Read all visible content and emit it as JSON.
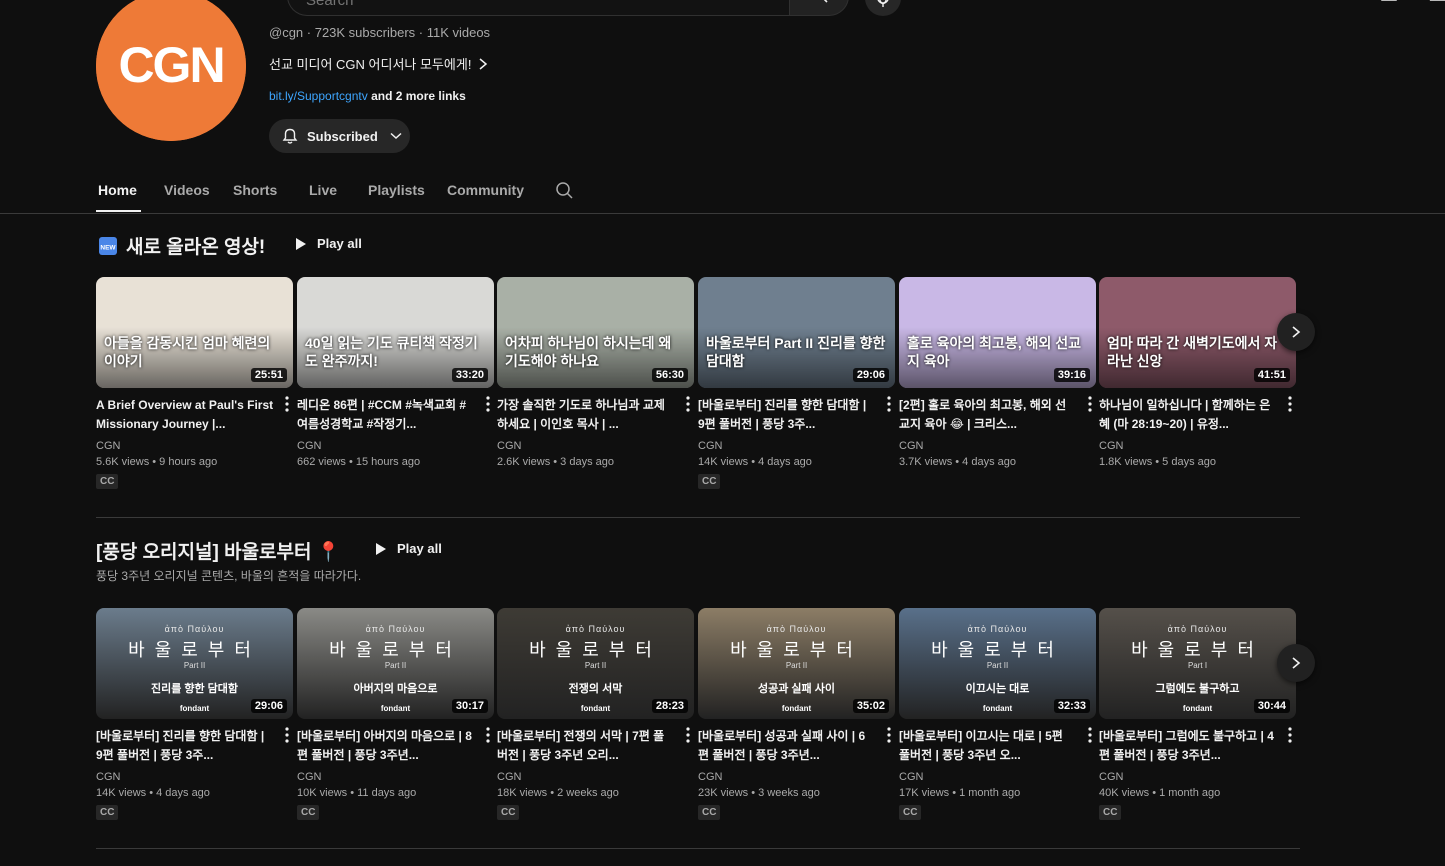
{
  "topbar": {
    "search_placeholder": "Search"
  },
  "channel": {
    "logo_text": "CGN",
    "handle_line": "@cgn · 723K subscribers · 11K videos",
    "tagline": "선교 미디어 CGN 어디서나 모두에게!",
    "link": "bit.ly/Supportcgntv",
    "more_links": "and 2 more links",
    "subscribe_label": "Subscribed",
    "brand_color": "#ee7a37"
  },
  "tabs": [
    "Home",
    "Videos",
    "Shorts",
    "Live",
    "Playlists",
    "Community"
  ],
  "sections": [
    {
      "badge": "NEW",
      "title": "새로 올라온 영상!",
      "play_all": "Play all",
      "videos": [
        {
          "thumb_text": "아들을 감동시킨 엄마 혜련의 이야기",
          "duration": "25:51",
          "title": "A Brief Overview at Paul's First Missionary Journey |...",
          "channel": "CGN",
          "meta": "5.6K views • 9 hours ago",
          "cc": "CC",
          "bg": "#e8e1d6"
        },
        {
          "thumb_text": "40일 읽는 기도 큐티책 작정기도 완주까지!",
          "duration": "33:20",
          "title": "레디온 86편 | #CCM #녹색교회 #여름성경학교 #작정기...",
          "channel": "CGN",
          "meta": "662 views • 15 hours ago",
          "cc": "",
          "bg": "#d9d9d6"
        },
        {
          "thumb_text": "어차피 하나님이 하시는데 왜 기도해야 하나요",
          "duration": "56:30",
          "title": "가장 솔직한 기도로 하나님과 교제하세요 | 이인호 목사 | ...",
          "channel": "CGN",
          "meta": "2.6K views • 3 days ago",
          "cc": "",
          "bg": "#a9b0a6"
        },
        {
          "thumb_text": "바울로부터 Part II 진리를 향한 담대함",
          "duration": "29:06",
          "title": "[바울로부터] 진리를 향한 담대함 | 9편 풀버전 | 풍당 3주...",
          "channel": "CGN",
          "meta": "14K views • 4 days ago",
          "cc": "CC",
          "bg": "#6f7f8f"
        },
        {
          "thumb_text": "홀로 육아의 최고봉, 해외 선교지 육아",
          "duration": "39:16",
          "title": "[2편] 홀로 육아의 최고봉, 해외 선교지 육아 😂 | 크리스...",
          "channel": "CGN",
          "meta": "3.7K views • 4 days ago",
          "cc": "",
          "bg": "#c9b8e6"
        },
        {
          "thumb_text": "엄마 따라 간 새벽기도에서 자라난 신앙",
          "duration": "41:51",
          "title": "하나님이 일하십니다 | 함께하는 은혜 (마 28:19~20) | 유정...",
          "channel": "CGN",
          "meta": "1.8K views • 5 days ago",
          "cc": "",
          "bg": "#8e5a6a"
        }
      ]
    },
    {
      "title": "[풍당 오리지널] 바울로부터 📍",
      "play_all": "Play all",
      "subtitle": "풍당 3주년 오리지널 콘텐츠, 바울의 흔적을 따라가다.",
      "series_greek": "ἀπὸ Παύλου",
      "series_title": "바울로부터",
      "brand": "fondant",
      "videos": [
        {
          "part": "Part II",
          "caption": "진리를 향한 담대함",
          "duration": "29:06",
          "title": "[바울로부터] 진리를 향한 담대함 | 9편 풀버전 | 풍당 3주...",
          "channel": "CGN",
          "meta": "14K views • 4 days ago",
          "cc": "CC",
          "bg": "#6b7c8c"
        },
        {
          "part": "Part II",
          "caption": "아버지의 마음으로",
          "duration": "30:17",
          "title": "[바울로부터] 아버지의 마음으로 | 8편 풀버전 | 풍당 3주년...",
          "channel": "CGN",
          "meta": "10K views • 11 days ago",
          "cc": "CC",
          "bg": "#8a8a86"
        },
        {
          "part": "Part II",
          "caption": "전쟁의 서막",
          "duration": "28:23",
          "title": "[바울로부터] 전쟁의 서막 | 7편 풀버전 | 풍당 3주년 오리...",
          "channel": "CGN",
          "meta": "18K views • 2 weeks ago",
          "cc": "CC",
          "bg": "#3e3b35"
        },
        {
          "part": "Part II",
          "caption": "성공과 실패 사이",
          "duration": "35:02",
          "title": "[바울로부터] 성공과 실패 사이 | 6편 풀버전 | 풍당 3주년...",
          "channel": "CGN",
          "meta": "23K views • 3 weeks ago",
          "cc": "CC",
          "bg": "#8c7d66"
        },
        {
          "part": "Part II",
          "caption": "이끄시는 대로",
          "duration": "32:33",
          "title": "[바울로부터] 이끄시는 대로 | 5편 풀버전 | 풍당 3주년 오...",
          "channel": "CGN",
          "meta": "17K views • 1 month ago",
          "cc": "CC",
          "bg": "#59708a"
        },
        {
          "part": "Part I",
          "caption": "그럼에도 불구하고",
          "duration": "30:44",
          "title": "[바울로부터] 그럼에도 불구하고 | 4편 풀버전 | 풍당 3주년...",
          "channel": "CGN",
          "meta": "40K views • 1 month ago",
          "cc": "CC",
          "bg": "#55504a"
        }
      ]
    }
  ]
}
